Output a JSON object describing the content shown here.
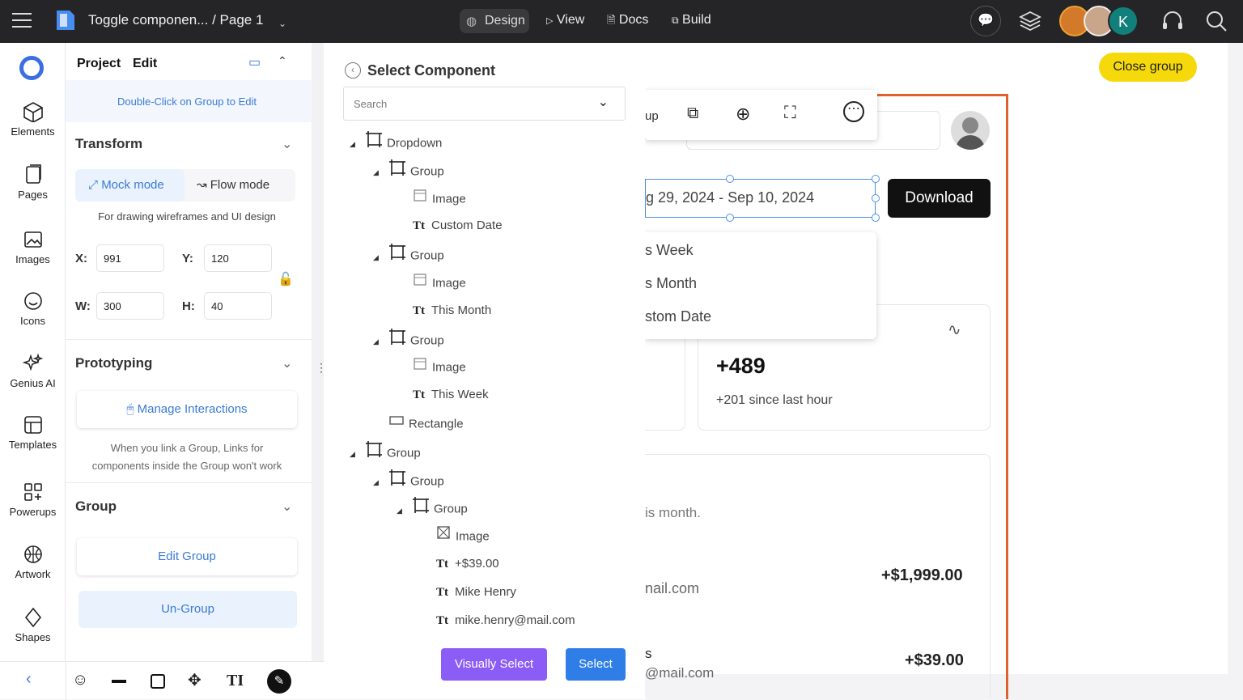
{
  "topbar": {
    "breadcrumb": "Toggle componen... / Page 1",
    "design": "Design",
    "view": "View",
    "docs": "Docs",
    "build": "Build",
    "avatar_k": "K"
  },
  "rail": {
    "items": [
      {
        "label": "Elements"
      },
      {
        "label": "Pages"
      },
      {
        "label": "Images"
      },
      {
        "label": "Icons"
      },
      {
        "label": "Genius AI"
      },
      {
        "label": "Templates"
      },
      {
        "label": "Powerups"
      },
      {
        "label": "Artwork"
      },
      {
        "label": "Shapes"
      }
    ]
  },
  "props": {
    "tab_project": "Project",
    "tab_edit": "Edit",
    "hint": "Double-Click on Group to Edit",
    "transform": "Transform",
    "mock_mode": "Mock mode",
    "flow_mode": "Flow mode",
    "mode_desc": "For drawing wireframes and UI design",
    "x_label": "X:",
    "x": "991",
    "y_label": "Y:",
    "y": "120",
    "w_label": "W:",
    "w": "300",
    "h_label": "H:",
    "h": "40",
    "prototyping": "Prototyping",
    "manage": "Manage Interactions",
    "proto_note_1": "When you link a Group, Links for",
    "proto_note_2": "components inside the Group won't work",
    "group": "Group",
    "edit_group": "Edit Group",
    "ungroup": "Un-Group"
  },
  "panel": {
    "title": "Select Component",
    "search_placeholder": "Search",
    "tree": [
      {
        "label": "Dropdown",
        "type": "frame",
        "depth": 0,
        "tri": true
      },
      {
        "label": "Group",
        "type": "frame",
        "depth": 1,
        "tri": true
      },
      {
        "label": "Image",
        "type": "image",
        "depth": 2
      },
      {
        "label": "Custom Date",
        "type": "text",
        "depth": 2
      },
      {
        "label": "Group",
        "type": "frame",
        "depth": 1,
        "tri": true
      },
      {
        "label": "Image",
        "type": "image",
        "depth": 2
      },
      {
        "label": "This Month",
        "type": "text",
        "depth": 2
      },
      {
        "label": "Group",
        "type": "frame",
        "depth": 1,
        "tri": true
      },
      {
        "label": "Image",
        "type": "image",
        "depth": 2
      },
      {
        "label": "This Week",
        "type": "text",
        "depth": 2
      },
      {
        "label": "Rectangle",
        "type": "rect",
        "depth": 1
      },
      {
        "label": "Group",
        "type": "frame",
        "depth": 0,
        "tri": true
      },
      {
        "label": "Group",
        "type": "frame",
        "depth": 1,
        "tri": true
      },
      {
        "label": "Group",
        "type": "frame",
        "depth": 2,
        "tri": true
      },
      {
        "label": "Image",
        "type": "imagex",
        "depth": 3
      },
      {
        "label": "+$39.00",
        "type": "text",
        "depth": 3
      },
      {
        "label": "Mike Henry",
        "type": "text",
        "depth": 3
      },
      {
        "label": "mike.henry@mail.com",
        "type": "text",
        "depth": 3
      }
    ],
    "visually_select": "Visually Select",
    "select": "Select"
  },
  "canvas": {
    "close_group": "Close group",
    "toolbar_partial": "up",
    "date_range": "g 29, 2024 - Sep 10, 2024",
    "download": "Download",
    "dd_week": "s Week",
    "dd_month": "s Month",
    "dd_custom": "stom Date",
    "stat_value": "+489",
    "stat_sub": "+201 since last hour",
    "this_month": "is month.",
    "email_partial": "nail.com",
    "amount1": "+$1,999.00",
    "s_partial": "s",
    "email_partial2": "@mail.com",
    "amount2": "+$39.00"
  }
}
